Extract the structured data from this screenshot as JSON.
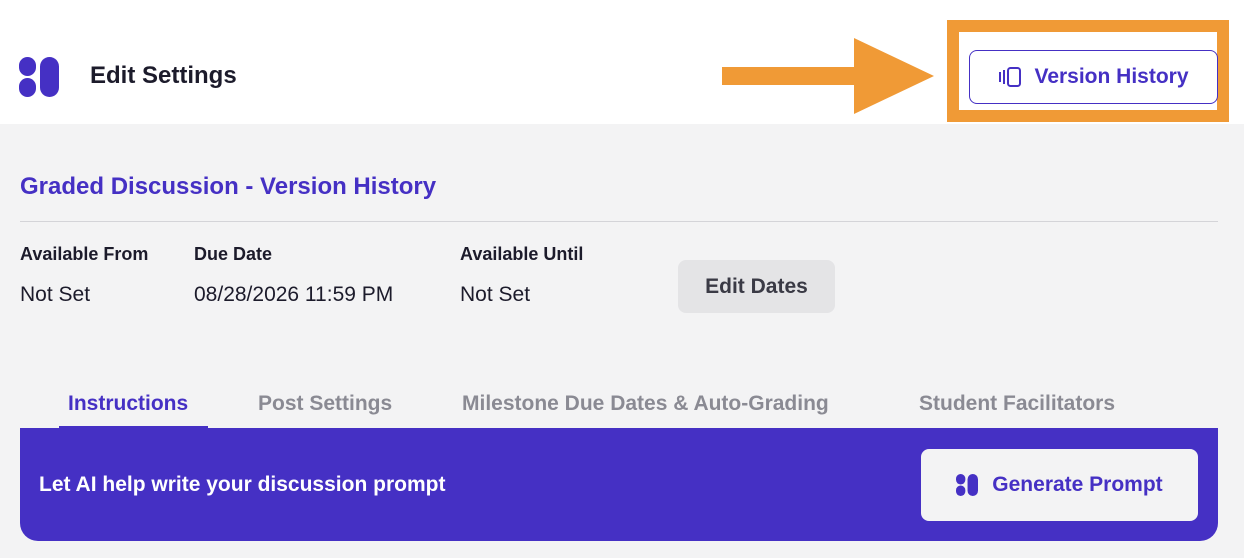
{
  "header": {
    "logo_icon": "brand-logo-icon",
    "title": "Edit Settings",
    "version_history_label": "Version History",
    "version_history_icon": "version-history-icon",
    "highlight_color": "#f09a36"
  },
  "discussion": {
    "title": "Graded Discussion - Version History",
    "dates": [
      {
        "label": "Available From",
        "value": "Not Set"
      },
      {
        "label": "Due Date",
        "value": "08/28/2026 11:59 PM"
      },
      {
        "label": "Available Until",
        "value": "Not Set"
      }
    ],
    "edit_dates_label": "Edit Dates"
  },
  "tabs": [
    {
      "label": "Instructions",
      "active": true
    },
    {
      "label": "Post Settings",
      "active": false
    },
    {
      "label": "Milestone Due Dates & Auto-Grading",
      "active": false
    },
    {
      "label": "Student Facilitators",
      "active": false
    }
  ],
  "ai_banner": {
    "text": "Let AI help write your discussion prompt",
    "button_label": "Generate Prompt",
    "button_icon": "ai-logo-icon"
  },
  "colors": {
    "accent": "#4530c4",
    "annotation": "#f09a36"
  }
}
